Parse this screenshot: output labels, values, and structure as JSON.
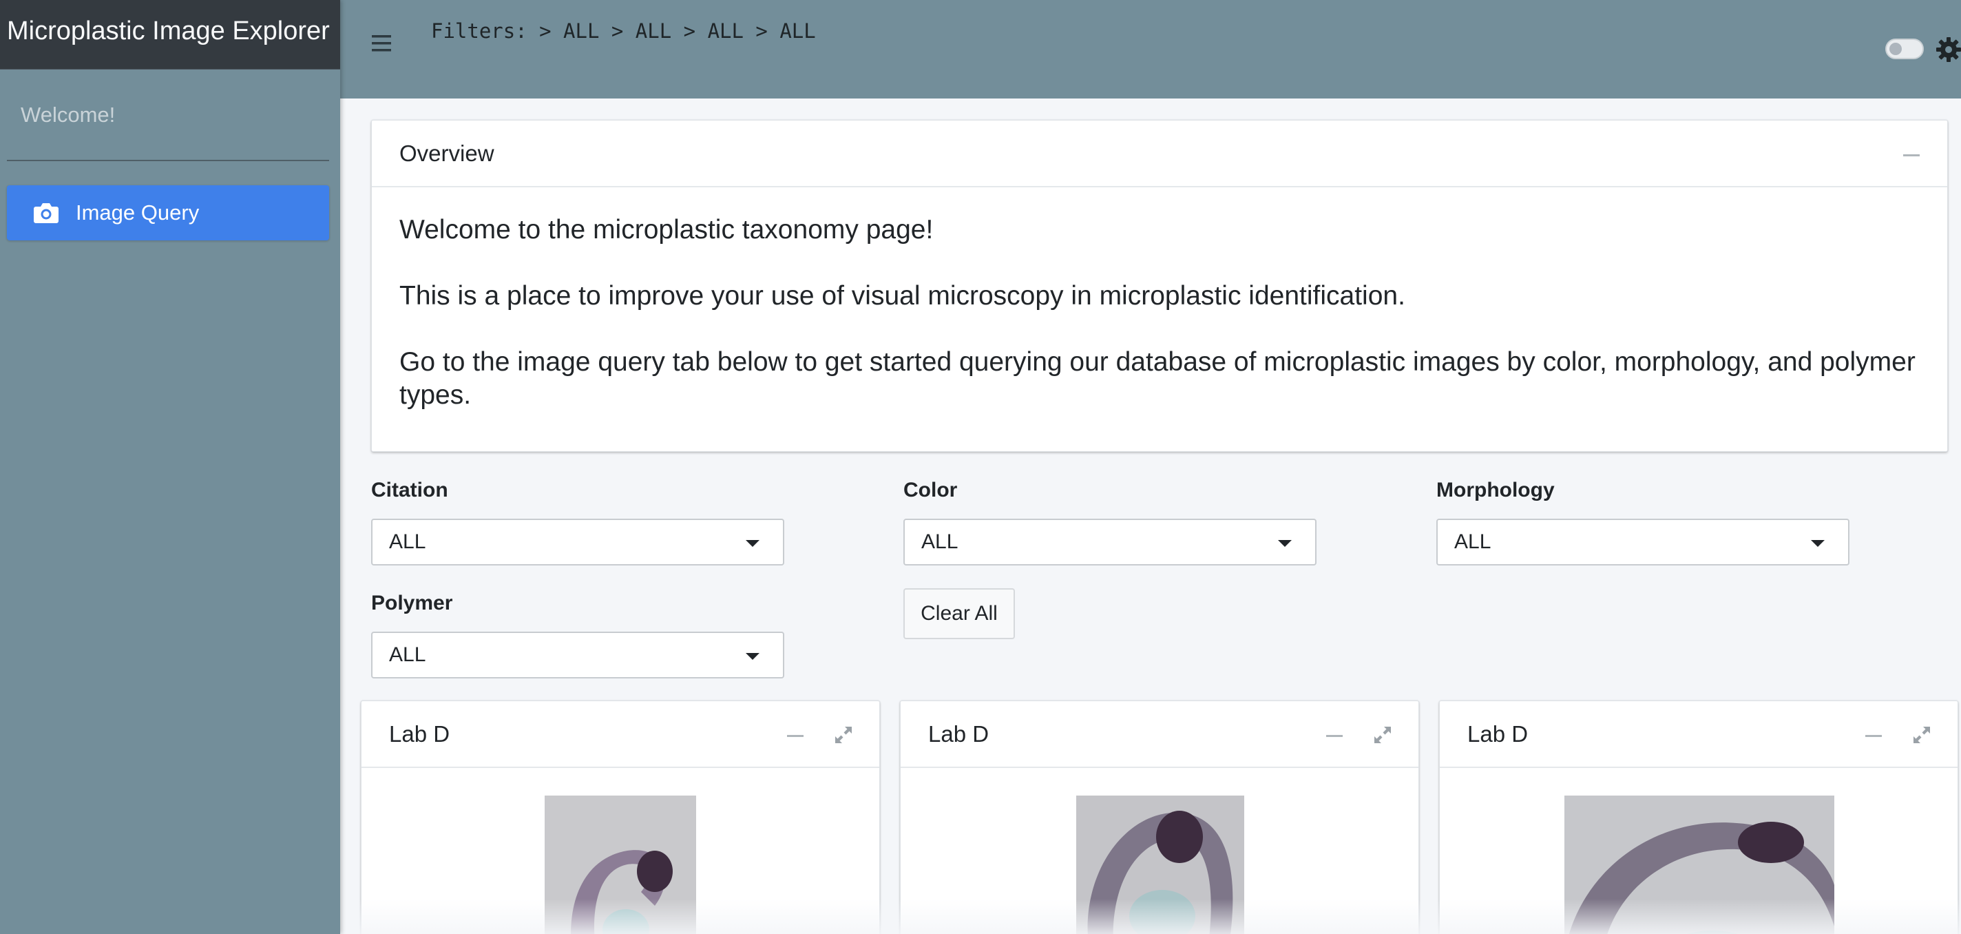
{
  "sidebar": {
    "brand": "Microplastic Image Explorer",
    "welcome": "Welcome!",
    "nav_items": [
      {
        "label": "Image Query",
        "icon": "camera-icon",
        "active": true
      }
    ]
  },
  "header": {
    "filters_text": "Filters: > ALL > ALL > ALL > ALL",
    "toggle_state": "off",
    "settings_icon": "gear-icon"
  },
  "overview": {
    "title": "Overview",
    "paragraphs": [
      "Welcome to the microplastic taxonomy page!",
      "This is a place to improve your use of visual microscopy in microplastic identification.",
      "Go to the image query tab below to get started querying our database of microplastic images by color, morphology, and polymer types."
    ]
  },
  "filters": {
    "citation": {
      "label": "Citation",
      "value": "ALL"
    },
    "color": {
      "label": "Color",
      "value": "ALL"
    },
    "morphology": {
      "label": "Morphology",
      "value": "ALL"
    },
    "polymer": {
      "label": "Polymer",
      "value": "ALL"
    },
    "clear_label": "Clear All"
  },
  "results": [
    {
      "title": "Lab D"
    },
    {
      "title": "Lab D"
    },
    {
      "title": "Lab D"
    }
  ],
  "colors": {
    "sidebar": "#738e9a",
    "brand_bg": "#343a40",
    "accent": "#3f80ea",
    "page_bg": "#f4f6f9"
  }
}
